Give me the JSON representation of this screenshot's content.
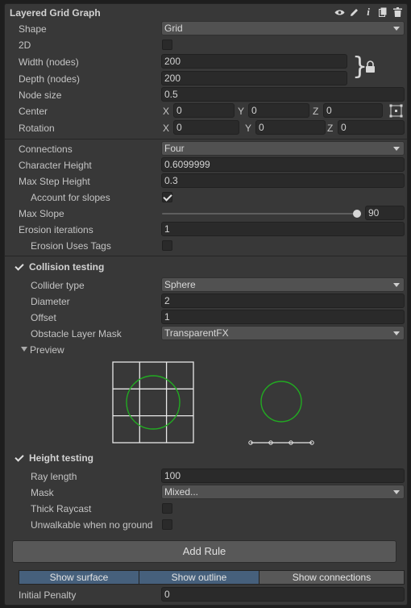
{
  "header": {
    "title": "Layered Grid Graph",
    "icons": [
      "eye-icon",
      "pencil-icon",
      "info-icon",
      "copy-icon",
      "trash-icon"
    ]
  },
  "shape": {
    "label": "Shape",
    "value": "Grid"
  },
  "two_d": {
    "label": "2D",
    "checked": false
  },
  "width": {
    "label": "Width (nodes)",
    "value": "200"
  },
  "depth": {
    "label": "Depth (nodes)",
    "value": "200"
  },
  "node_size": {
    "label": "Node size",
    "value": "0.5"
  },
  "center": {
    "label": "Center",
    "x_label": "X",
    "x": "0",
    "y_label": "Y",
    "y": "0",
    "z_label": "Z",
    "z": "0"
  },
  "rotation": {
    "label": "Rotation",
    "x_label": "X",
    "x": "0",
    "y_label": "Y",
    "y": "0",
    "z_label": "Z",
    "z": "0"
  },
  "connections": {
    "label": "Connections",
    "value": "Four"
  },
  "character_height": {
    "label": "Character Height",
    "value": "0.6099999"
  },
  "max_step_height": {
    "label": "Max Step Height",
    "value": "0.3"
  },
  "account_slopes": {
    "label": "Account for slopes",
    "checked": true
  },
  "max_slope": {
    "label": "Max Slope",
    "value": "90",
    "fraction": 1.0
  },
  "erosion_iterations": {
    "label": "Erosion iterations",
    "value": "1"
  },
  "erosion_tags": {
    "label": "Erosion Uses Tags",
    "checked": false
  },
  "collision": {
    "title": "Collision testing",
    "enabled": true,
    "collider_type": {
      "label": "Collider type",
      "value": "Sphere"
    },
    "diameter": {
      "label": "Diameter",
      "value": "2"
    },
    "offset": {
      "label": "Offset",
      "value": "1"
    },
    "mask": {
      "label": "Obstacle Layer Mask",
      "value": "TransparentFX"
    },
    "preview": {
      "label": "Preview",
      "expanded": true
    }
  },
  "height": {
    "title": "Height testing",
    "enabled": true,
    "ray_length": {
      "label": "Ray length",
      "value": "100"
    },
    "mask": {
      "label": "Mask",
      "value": "Mixed..."
    },
    "thick_raycast": {
      "label": "Thick Raycast",
      "checked": false
    },
    "unwalkable": {
      "label": "Unwalkable when no ground",
      "checked": false
    }
  },
  "add_rule": {
    "label": "Add Rule"
  },
  "show": {
    "surface": "Show surface",
    "outline": "Show outline",
    "connections": "Show connections"
  },
  "initial_penalty": {
    "label": "Initial Penalty",
    "value": "0"
  },
  "colors": {
    "panel": "#383838",
    "field": "#2a2a2a",
    "dropdown": "#515151",
    "accent": "#46607c",
    "preview_circle": "#22aa22"
  }
}
